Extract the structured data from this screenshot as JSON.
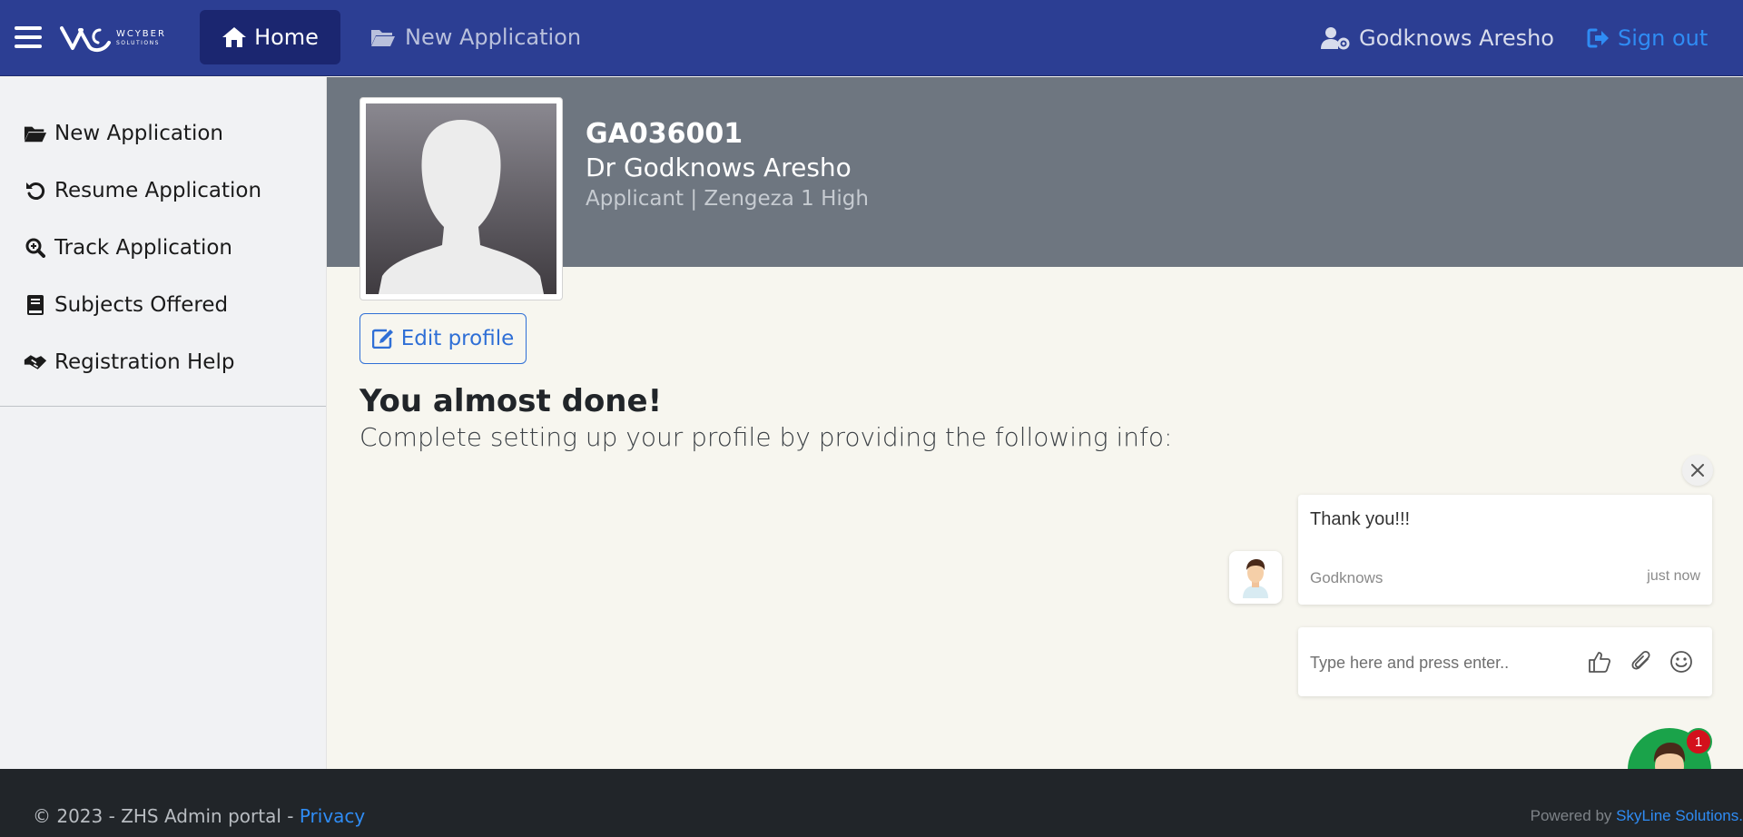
{
  "nav": {
    "home_label": "Home",
    "new_application_label": "New Application",
    "user_name": "Godknows Aresho",
    "signout_label": "Sign out",
    "logo_line1": "WCYBER",
    "logo_line2": "SOLUTIONS"
  },
  "sidebar": {
    "items": [
      {
        "label": "New Application",
        "icon": "folder-open-icon"
      },
      {
        "label": "Resume Application",
        "icon": "undo-icon"
      },
      {
        "label": "Track Application",
        "icon": "search-zoom-icon"
      },
      {
        "label": "Subjects Offered",
        "icon": "book-icon"
      },
      {
        "label": "Registration Help",
        "icon": "handshake-icon"
      }
    ]
  },
  "profile": {
    "code": "GA036001",
    "name": "Dr Godknows Aresho",
    "role": "Applicant | Zengeza 1 High",
    "edit_label": "Edit profile"
  },
  "main": {
    "headline": "You almost done!",
    "subline": "Complete setting up your profile by providing the following info:"
  },
  "chat": {
    "message_text": "Thank you!!!",
    "message_from": "Godknows",
    "message_time": "just now",
    "input_placeholder": "Type here and press enter..",
    "unread_count": "1"
  },
  "footer": {
    "copyright": "© 2023 - ZHS Admin portal - ",
    "privacy_label": "Privacy",
    "powered_by": "Powered by ",
    "powered_link": "SkyLine Solutions."
  },
  "colors": {
    "navbar": "#2c3e93",
    "nav_active": "#1b2670",
    "accent": "#2f8cf4",
    "profile_band": "#6e7680",
    "footer": "#212529",
    "chat_launcher": "#1aa34a"
  }
}
